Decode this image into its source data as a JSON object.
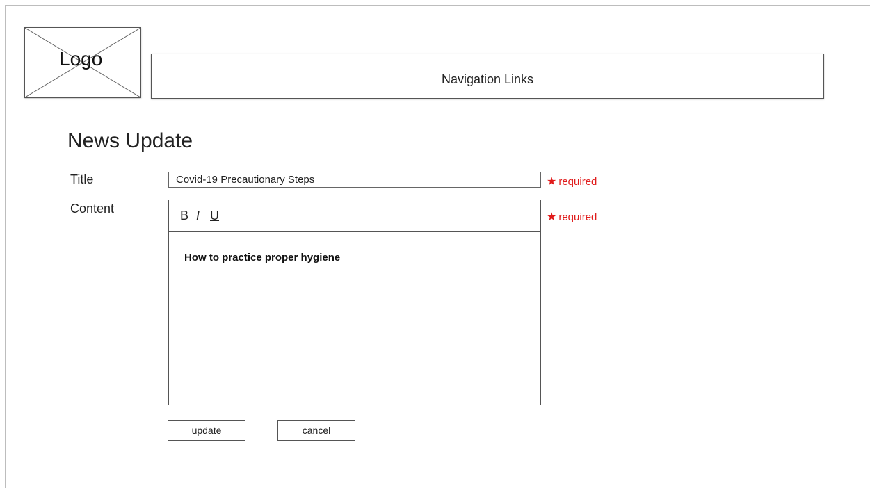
{
  "header": {
    "logo_label": "Logo",
    "nav_label": "Navigation Links"
  },
  "page": {
    "title": "News Update"
  },
  "form": {
    "title_label": "Title",
    "title_value": "Covid-19 Precautionary Steps",
    "title_required": "required",
    "content_label": "Content",
    "content_required": "required",
    "toolbar": {
      "bold": "B",
      "italic": "I",
      "underline": "U"
    },
    "content_text": "How to practice proper hygiene",
    "update_label": "update",
    "cancel_label": "cancel"
  },
  "colors": {
    "required": "#e01b1b"
  },
  "icons": {
    "required_marker": "asterisk-icon",
    "logo_placeholder": "image-placeholder-icon"
  }
}
